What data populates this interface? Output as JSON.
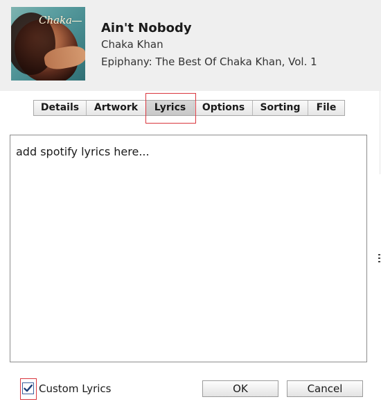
{
  "track": {
    "title": "Ain't Nobody",
    "artist": "Chaka Khan",
    "album": "Epiphany: The Best Of Chaka Khan, Vol. 1"
  },
  "artwork": {
    "text": "Chaka"
  },
  "tabs": [
    {
      "label": "Details",
      "active": false
    },
    {
      "label": "Artwork",
      "active": false
    },
    {
      "label": "Lyrics",
      "active": true
    },
    {
      "label": "Options",
      "active": false
    },
    {
      "label": "Sorting",
      "active": false
    },
    {
      "label": "File",
      "active": false
    }
  ],
  "lyrics": {
    "value": "add spotify lyrics here..."
  },
  "footer": {
    "custom_lyrics_label": "Custom Lyrics",
    "custom_lyrics_checked": true,
    "ok_label": "OK",
    "cancel_label": "Cancel"
  },
  "colors": {
    "highlight": "#d9363e",
    "checkbox_accent": "#3a5f9c"
  }
}
